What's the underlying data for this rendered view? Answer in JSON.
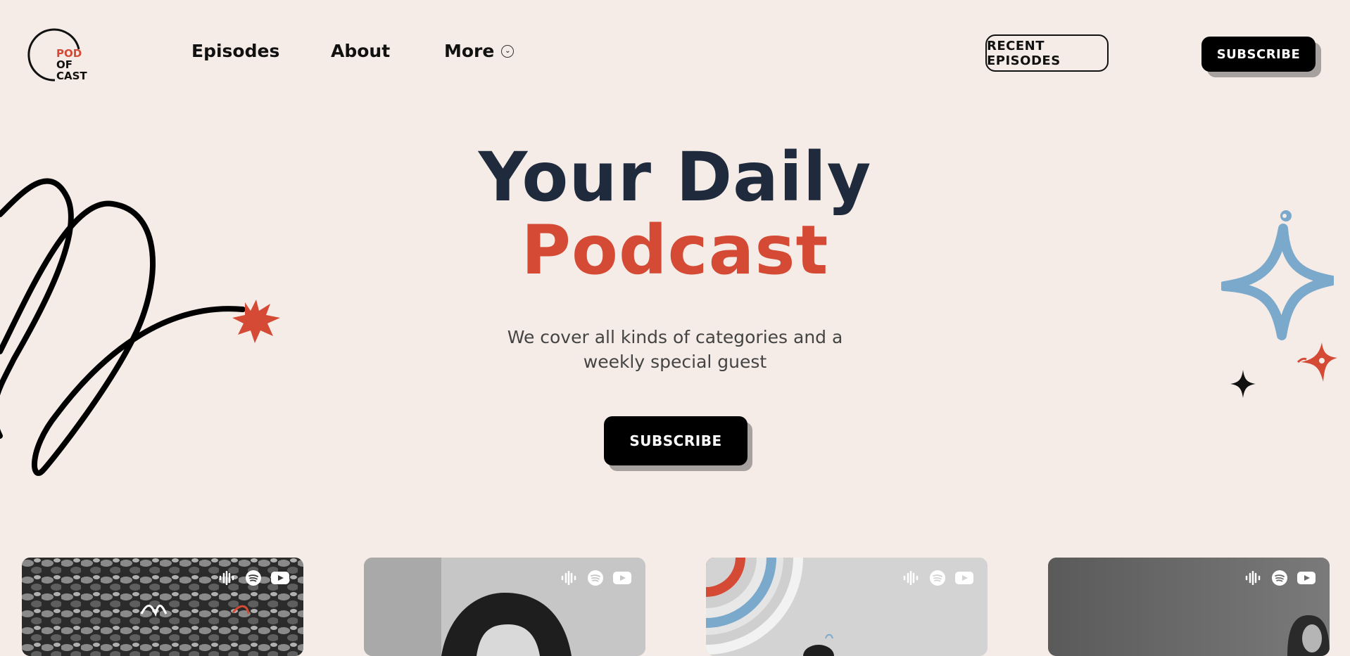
{
  "logo": {
    "line1": "POD",
    "line2": "OF",
    "line3": "CAST"
  },
  "nav": {
    "episodes": "Episodes",
    "about": "About",
    "more": "More"
  },
  "header_buttons": {
    "recent_episodes": "RECENT EPISODES",
    "subscribe": "SUBSCRIBE"
  },
  "hero": {
    "title_line1": "Your Daily",
    "title_line2": "Podcast",
    "subtitle_line1": "We cover all kinds of categories and a",
    "subtitle_line2": "weekly special guest",
    "cta": "SUBSCRIBE"
  },
  "colors": {
    "background": "#f5ece7",
    "accent_red": "#d44a35",
    "navy": "#1f2a3c",
    "blue": "#7aa9cc",
    "black": "#000000"
  },
  "cards": [
    {
      "image": "grayscale-flowers-photo",
      "icons": [
        "podcast-icon",
        "spotify-icon",
        "youtube-icon"
      ]
    },
    {
      "image": "grayscale-portrait-photo",
      "icons": [
        "podcast-icon",
        "spotify-icon",
        "youtube-icon"
      ]
    },
    {
      "image": "arcs-illustration",
      "icons": [
        "podcast-icon",
        "spotify-icon",
        "youtube-icon"
      ]
    },
    {
      "image": "grayscale-person-photo",
      "icons": [
        "podcast-icon",
        "spotify-icon",
        "youtube-icon"
      ]
    }
  ]
}
